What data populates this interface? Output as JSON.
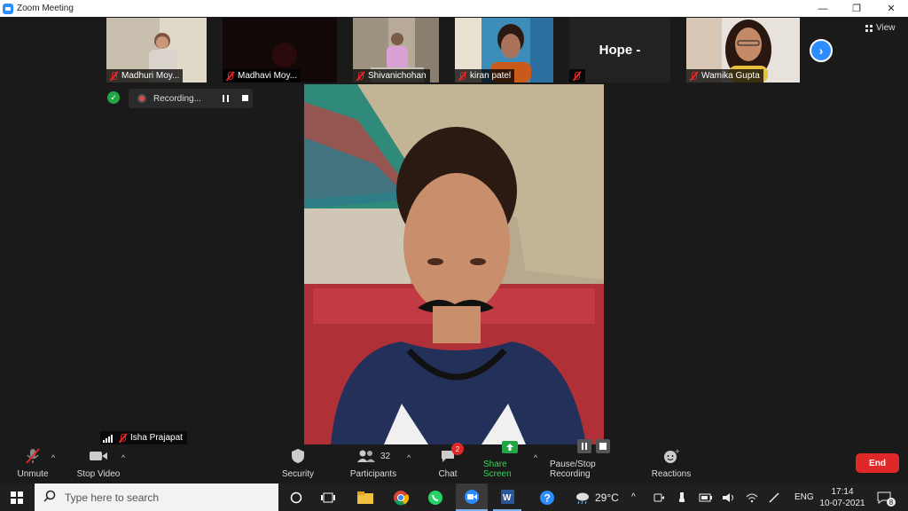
{
  "window": {
    "title": "Zoom Meeting",
    "minimize": "—",
    "restore": "❐",
    "close": "✕"
  },
  "thumbnails": [
    {
      "name": "Madhuri Moy...",
      "muted": true
    },
    {
      "name": "Madhavi Moy...",
      "muted": true
    },
    {
      "name": "Shivanichohan",
      "muted": true
    },
    {
      "name": "kiran patel",
      "muted": true
    },
    {
      "name": "",
      "card_text": "Hope -",
      "muted": true
    },
    {
      "name": "Wamika Gupta",
      "muted": true
    }
  ],
  "view_button": "View",
  "recording": {
    "label": "Recording..."
  },
  "active_speaker": {
    "name": "Isha Prajapat"
  },
  "toolbar": {
    "unmute": "Unmute",
    "stop_video": "Stop Video",
    "security": "Security",
    "participants": "Participants",
    "participants_count": "32",
    "chat": "Chat",
    "chat_badge": "2",
    "share_screen": "Share Screen",
    "pause_stop_recording": "Pause/Stop Recording",
    "reactions": "Reactions",
    "end": "End"
  },
  "taskbar": {
    "search_placeholder": "Type here to search",
    "weather": "29°C",
    "language": "ENG",
    "time": "17:14",
    "date": "10-07-2021",
    "notifications": "8"
  },
  "colors": {
    "accent": "#2d8cff",
    "end_red": "#e02828",
    "share_green": "#23a645"
  }
}
